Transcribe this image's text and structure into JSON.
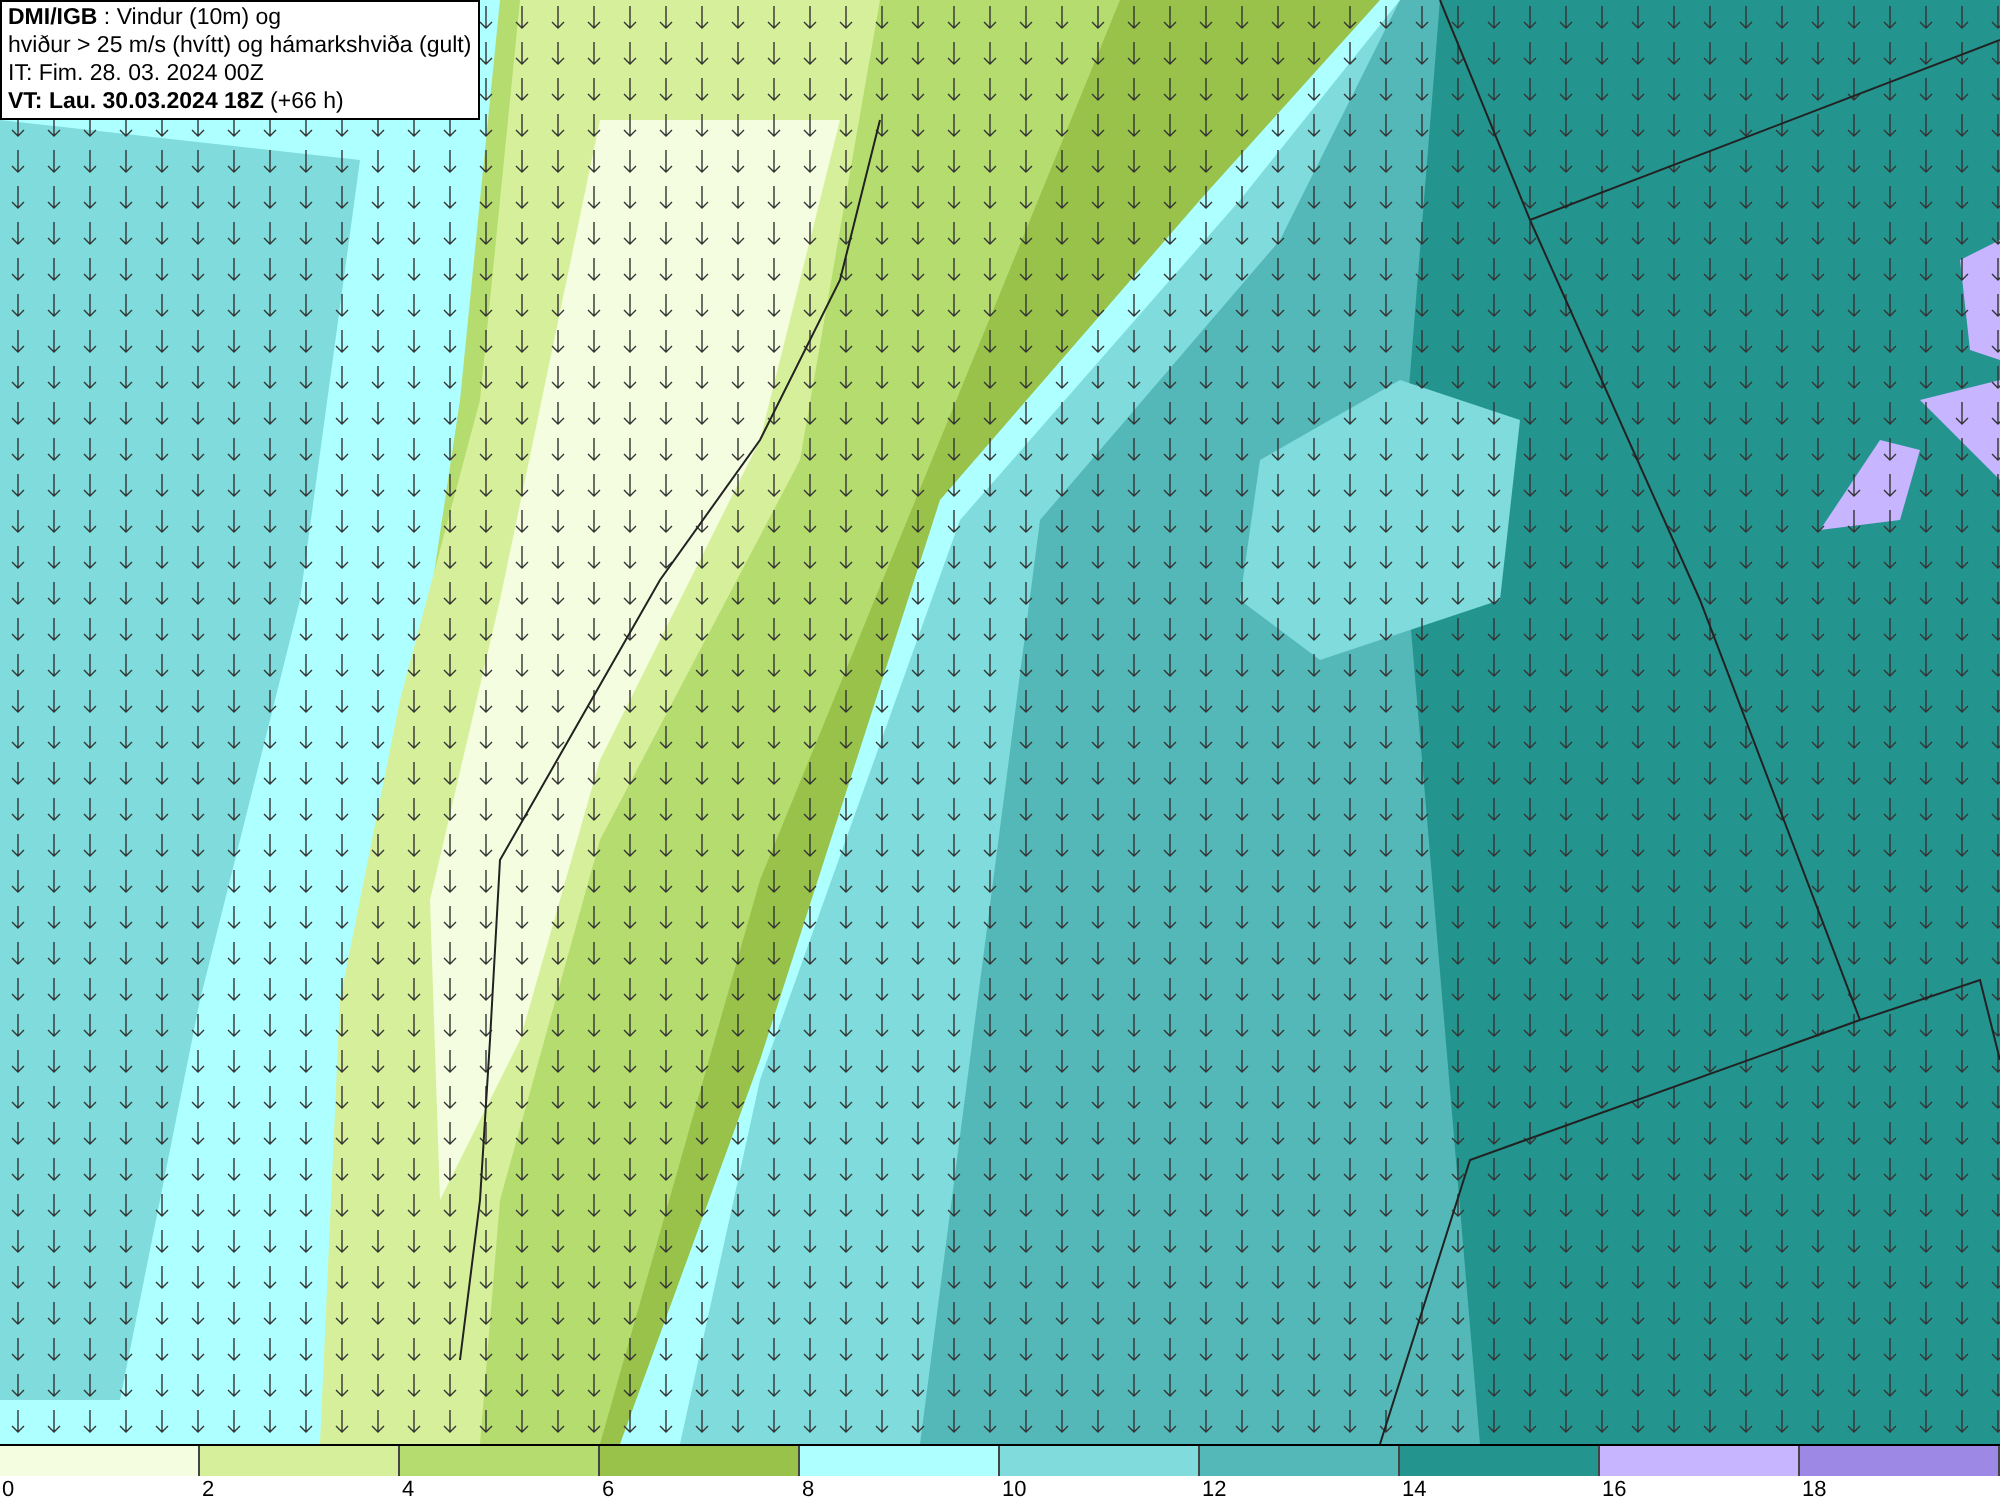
{
  "header": {
    "lines": [
      "**DMI/IGB** : Vindur (10m) og",
      "hviður > 25 m/s (hvítt) og hámarkshviða (gult)",
      "IT: Fim. 28. 03. 2024 00Z",
      "**VT: Lau. 30.03.2024 18Z** (+66 h)"
    ]
  },
  "legend": {
    "bins": [
      {
        "label": "0",
        "color": "#f5fde0"
      },
      {
        "label": "2",
        "color": "#d6ef9a"
      },
      {
        "label": "4",
        "color": "#b5dc6f"
      },
      {
        "label": "6",
        "color": "#98c24a"
      },
      {
        "label": "8",
        "color": "#aeffff"
      },
      {
        "label": "10",
        "color": "#80dcdc"
      },
      {
        "label": "12",
        "color": "#55b8b8"
      },
      {
        "label": "14",
        "color": "#24948f"
      },
      {
        "label": "16",
        "color": "#c7b5ff"
      },
      {
        "label": "18",
        "color": "#9e88e6"
      }
    ]
  }
}
